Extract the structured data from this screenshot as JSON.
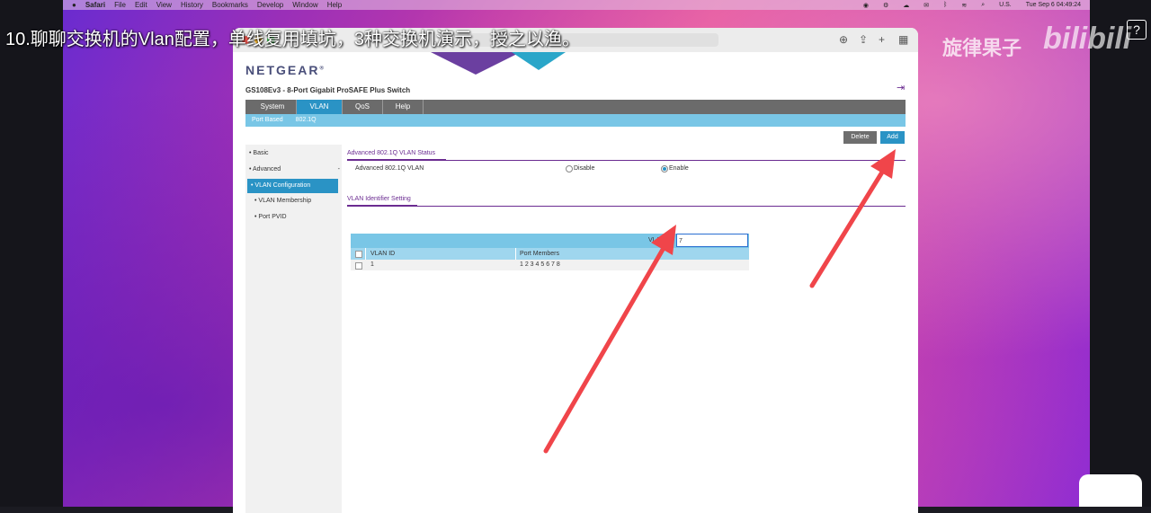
{
  "caption": "10.聊聊交换机的Vlan配置，单线复用填坑，3种交换机演示，授之以渔。",
  "watermark": "旋律果子",
  "bili_logo": "bilibili",
  "help_icon": "?",
  "menubar": {
    "apple": "",
    "items": [
      "Safari",
      "File",
      "Edit",
      "View",
      "History",
      "Bookmarks",
      "Develop",
      "Window",
      "Help"
    ],
    "input_source": "U.S.",
    "clock": "Tue Sep 6  04:49:24"
  },
  "page": {
    "brand": "NETGEAR",
    "brand_mark": "®",
    "model": "GS108Ev3 - 8-Port Gigabit ProSAFE Plus Switch",
    "main_tabs": [
      "System",
      "VLAN",
      "QoS",
      "Help"
    ],
    "active_tab": "VLAN",
    "sub_tabs": [
      "Port Based",
      "802.1Q"
    ],
    "buttons": {
      "delete": "Delete",
      "add": "Add"
    },
    "left_nav": {
      "basic": "Basic",
      "advanced": "Advanced",
      "items": [
        "VLAN Configuration",
        "VLAN Membership",
        "Port PVID"
      ]
    },
    "status_section": {
      "title": "Advanced 802.1Q VLAN Status",
      "label": "Advanced 802.1Q VLAN",
      "disable": "Disable",
      "enable": "Enable",
      "selected": "Enable"
    },
    "identifier_section": {
      "title": "VLAN Identifier Setting",
      "vlan_id_label": "VLAN ID",
      "vlan_id_value": "7",
      "columns": [
        "VLAN ID",
        "Port Members"
      ],
      "rows": [
        {
          "vlan_id": "1",
          "port_members": "1 2 3 4 5 6 7 8"
        }
      ]
    }
  },
  "colors": {
    "accent_blue": "#2a93c5",
    "light_blue": "#79c6e6",
    "purple": "#6b2c91",
    "arrow_red": "#f0454a"
  }
}
